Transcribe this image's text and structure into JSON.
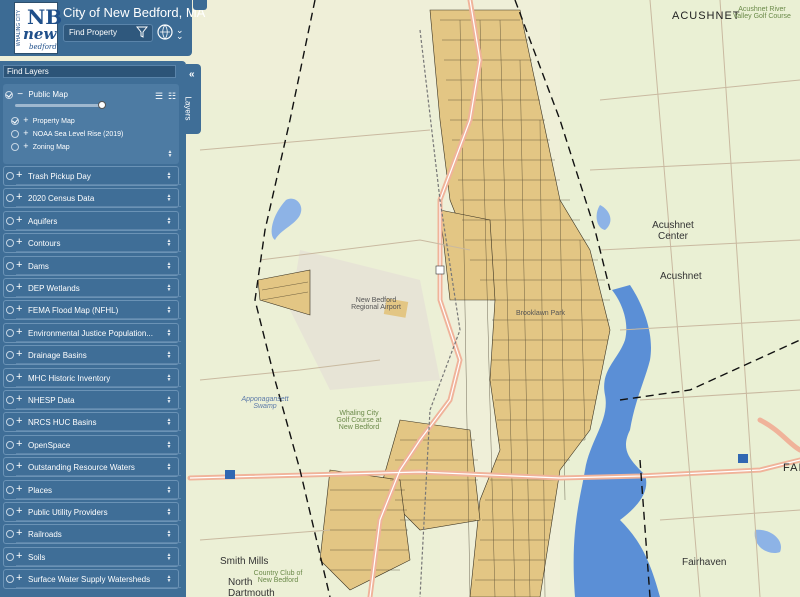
{
  "header": {
    "title": "City of New Bedford, MA",
    "find_property_placeholder": "Find Property",
    "logo_text_nb": "NB",
    "logo_text_new": "new",
    "logo_text_bedford": "bedford",
    "logo_vertical": "WHALING CITY"
  },
  "panel": {
    "find_layers_placeholder": "Find Layers",
    "layers_tab_label": "Layers",
    "public_map": {
      "label": "Public Map",
      "sublayers": [
        {
          "label": "Property Map",
          "checked": true
        },
        {
          "label": "NOAA Sea Level Rise (2019)",
          "checked": false
        },
        {
          "label": "Zoning Map",
          "checked": false
        }
      ]
    },
    "layers": [
      "Trash Pickup Day",
      "2020 Census Data",
      "Aquifers",
      "Contours",
      "Dams",
      "DEP Wetlands",
      "FEMA Flood Map (NFHL)",
      "Environmental Justice Population...",
      "Drainage Basins",
      "MHC Historic Inventory",
      "NHESP Data",
      "NRCS HUC Basins",
      "OpenSpace",
      "Outstanding Resource Waters",
      "Places",
      "Public Utility Providers",
      "Railroads",
      "Soils",
      "Surface Water Supply Watersheds"
    ]
  },
  "map": {
    "labels": {
      "acushnet_big": "ACUSHNET",
      "acushnet_center": "Acushnet Center",
      "acushnet": "Acushnet",
      "airport": "New Bedford Regional Airport",
      "brooklawn": "Brooklawn Park",
      "whaling_golf": "Whaling City Golf Course at New Bedford",
      "appo_swamp": "Apponagansett Swamp",
      "smith_mills": "Smith Mills",
      "north_dartmouth": "North Dartmouth",
      "country_club": "Country Club of New Bedford",
      "fairhaven": "Fairhaven",
      "fai": "FAI",
      "river_valley": "Acushnet River Valley Golf Course"
    },
    "colors": {
      "land": "#efefd8",
      "water": "#5b8fd6",
      "parcel": "#e3c684",
      "road": "#f2b9a0"
    }
  }
}
